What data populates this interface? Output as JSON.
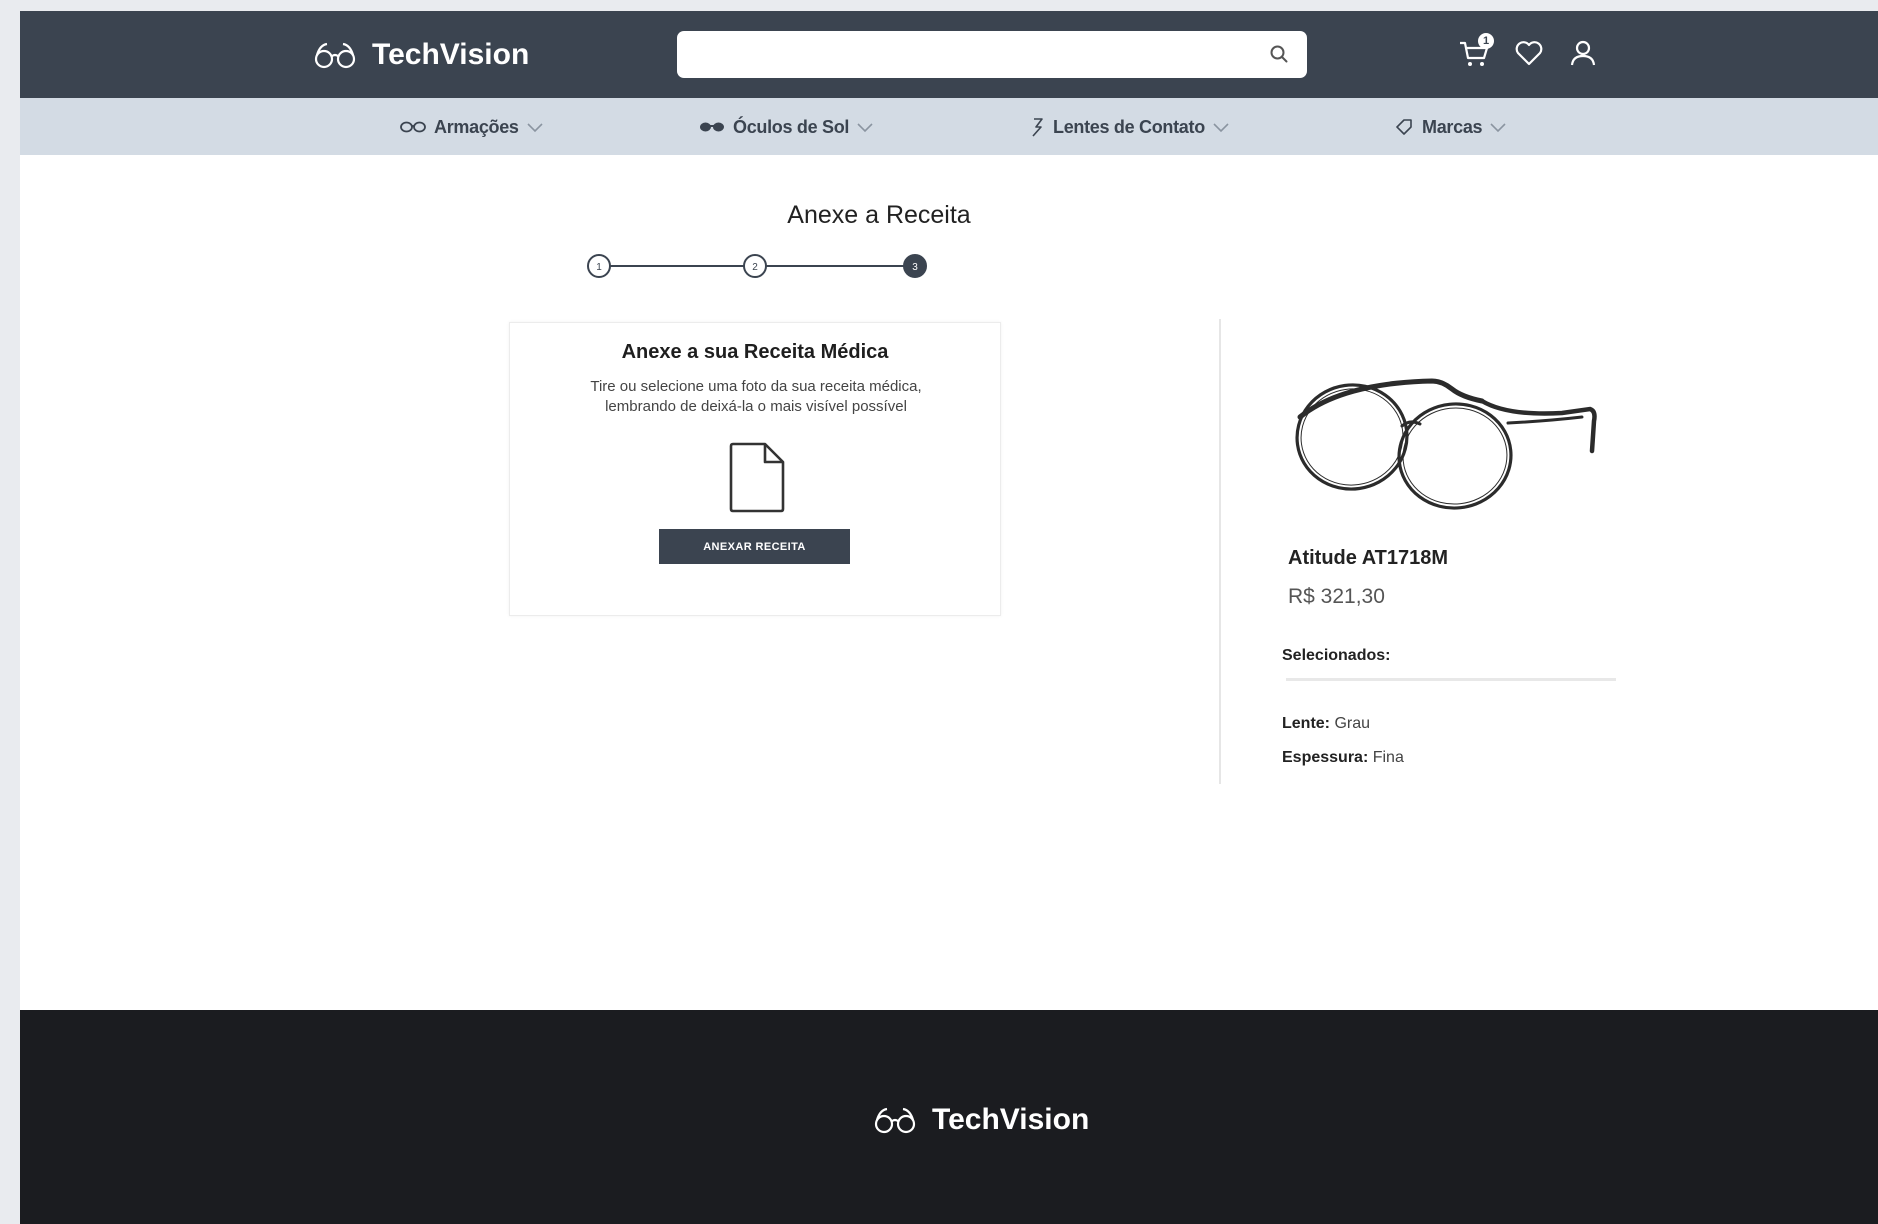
{
  "header": {
    "brand": "TechVision",
    "search": {
      "value": "",
      "placeholder": ""
    },
    "cart_count": "1"
  },
  "nav": {
    "categories": [
      {
        "label": "Armações",
        "icon": "glasses-outline-icon"
      },
      {
        "label": "Óculos de Sol",
        "icon": "sunglasses-icon"
      },
      {
        "label": "Lentes de Contato",
        "icon": "contact-lens-icon"
      },
      {
        "label": "Marcas",
        "icon": "tag-icon"
      }
    ]
  },
  "step": {
    "title": "Anexe a Receita",
    "steps": [
      "1",
      "2",
      "3"
    ],
    "current": 3
  },
  "upload": {
    "title": "Anexe a sua Receita Médica",
    "description_line1": "Tire ou selecione uma foto da sua receita médica,",
    "description_line2": "lembrando de deixá-la o mais visível possível",
    "button_label": "ANEXAR RECEITA"
  },
  "product": {
    "name": "Atitude AT1718M",
    "price": "R$ 321,30",
    "selected_title": "Selecionados:",
    "attributes": [
      {
        "label": "Lente:",
        "value": "Grau"
      },
      {
        "label": "Espessura:",
        "value": "Fina"
      }
    ]
  },
  "footer": {
    "brand": "TechVision"
  },
  "colors": {
    "header_bg": "#3b4450",
    "nav_bg": "#d3dbe4",
    "footer_bg": "#1b1c20",
    "button_bg": "#3b4450"
  }
}
